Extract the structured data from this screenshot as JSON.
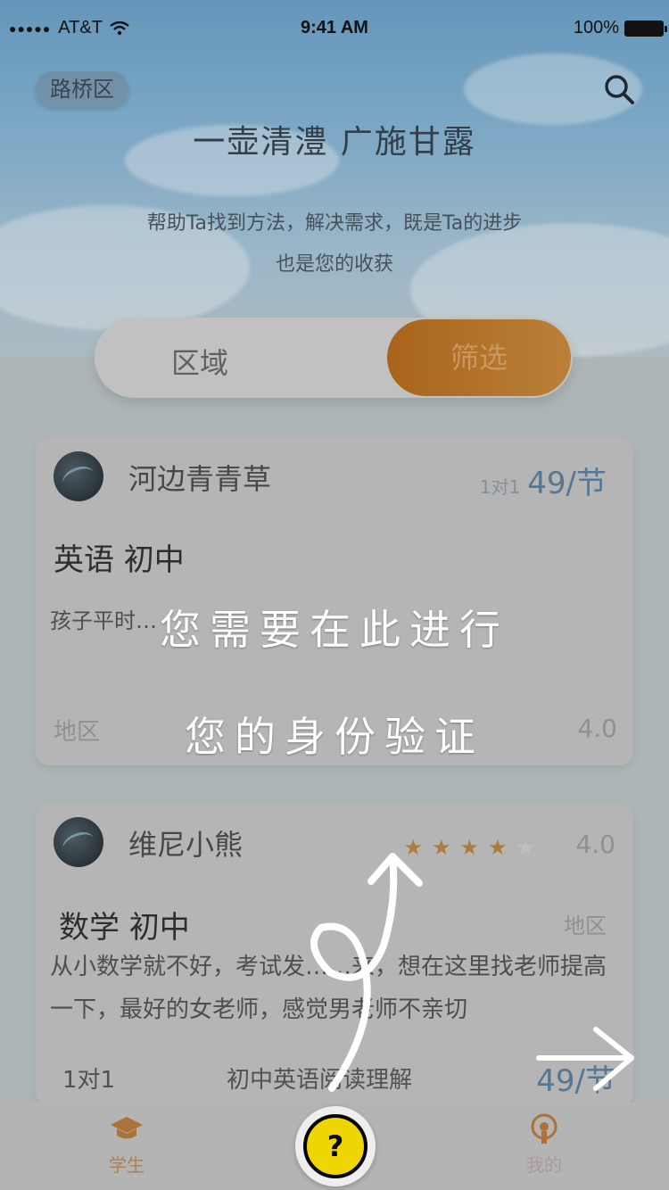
{
  "status_bar": {
    "carrier": "AT&T",
    "time": "9:41 AM",
    "battery": "100%"
  },
  "header": {
    "region": "路桥区",
    "slogan": "一壶清澧 广施甘露",
    "sub_line1": "帮助Ta找到方法，解决需求，既是Ta的进步",
    "sub_line2": "也是您的收获"
  },
  "filter_bar": {
    "region_label": "区域",
    "filter_label": "筛选"
  },
  "cards": [
    {
      "name": "河边青青草",
      "type": "1对1",
      "price": "49/节",
      "subject": "英语 初中",
      "description": "孩子平时…",
      "loc": "地区",
      "rating": "4.0"
    },
    {
      "name": "维尼小熊",
      "rating": "4.0",
      "stars": 4,
      "subject": "数学 初中",
      "loc": "地区",
      "description": "从小数学就不好，考试发……来，想在这里找老师提高一下，最好的女老师，感觉男老师不亲切",
      "mode": "1对1",
      "course": "初中英语阅读理解",
      "price": "49/节"
    }
  ],
  "overlay": {
    "line1": "您需要在此进行",
    "line2": "您的身份验证"
  },
  "tabbar": {
    "student": "学生",
    "mine": "我的"
  },
  "colors": {
    "accent": "#c8883a",
    "price": "#5b7e9b",
    "bulb": "#ffe400"
  }
}
